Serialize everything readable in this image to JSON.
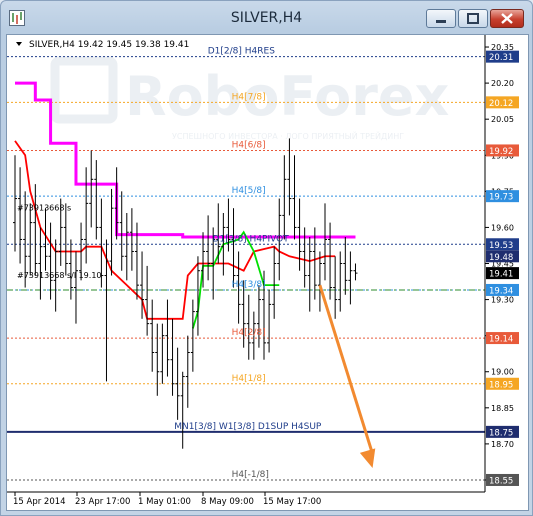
{
  "window": {
    "title": "SILVER,H4"
  },
  "info_bar": {
    "text": "SILVER,H4  19.42 19.45 19.38 19.41"
  },
  "watermark": "RoboForex",
  "watermark_sub": "УСПЕШНОГО ИНВЕСТОРА · ЛОГО ПРИЯТНЫЙ ТРЕЙДИНГ",
  "chart_data": {
    "type": "candlestick",
    "symbol": "SILVER",
    "timeframe": "H4",
    "last": {
      "open": 19.42,
      "high": 19.45,
      "low": 19.38,
      "close": 19.41
    },
    "ylim": [
      18.5,
      20.4
    ],
    "y_ticks": [
      "20.35",
      "20.20",
      "20.05",
      "19.90",
      "19.75",
      "19.60",
      "19.45",
      "19.30",
      "19.15",
      "19.00",
      "18.85",
      "18.70",
      "18.55"
    ],
    "x_ticks": [
      "15 Apr 2014",
      "23 Apr 17:00",
      "1 May 01:00",
      "8 May 09:00",
      "15 May 17:00"
    ],
    "levels": [
      {
        "label": "D1[2/8] H4RES",
        "price": 20.31,
        "badge": "20.31",
        "color": "#1f3d8a",
        "style": "dot",
        "label_color": "#1f3d8a",
        "label_x": 0.42
      },
      {
        "label": "H4[7/8]",
        "price": 20.12,
        "badge": "20.12",
        "color": "#f5a623",
        "style": "dot",
        "label_color": "#f5a623",
        "label_x": 0.47
      },
      {
        "label": "H4[6/8]",
        "price": 19.92,
        "badge": "19.92",
        "color": "#e85a3a",
        "style": "dot",
        "label_color": "#e85a3a",
        "label_x": 0.47
      },
      {
        "label": "H4[5/8]",
        "price": 19.73,
        "badge": "19.73",
        "color": "#2f8fe0",
        "style": "dot",
        "label_color": "#2f8fe0",
        "label_x": 0.47
      },
      {
        "label": "D1[3/8] H4PIVOT",
        "price": 19.53,
        "badge": "19.53",
        "color": "#1f3d8a",
        "style": "dot",
        "label_color": "#1f3d8a",
        "label_x": 0.43
      },
      {
        "label": "H4[3/8]",
        "price": 19.34,
        "badge": "19.34",
        "color": "#2f8fe0",
        "style": "dot",
        "label_color": "#2f8fe0",
        "label_x": 0.47
      },
      {
        "label": "H4[2/8]",
        "price": 19.14,
        "badge": "19.14",
        "color": "#e85a3a",
        "style": "dot",
        "label_color": "#e85a3a",
        "label_x": 0.47
      },
      {
        "label": "H4[1/8]",
        "price": 18.95,
        "badge": "18.95",
        "color": "#f5a623",
        "style": "dot",
        "label_color": "#f5a623",
        "label_x": 0.47
      },
      {
        "label": "MN1[3/8] W1[3/8] D1SUP H4SUP",
        "price": 18.75,
        "badge": "18.75",
        "color": "#1f2d6e",
        "style": "solid",
        "label_color": "#1f3d8a",
        "label_x": 0.35
      },
      {
        "label": "H4[-1/8]",
        "price": 18.55,
        "badge": "18.55",
        "color": "#555555",
        "style": "dot",
        "label_color": "#555555",
        "label_x": 0.47
      }
    ],
    "extra_badges": [
      {
        "price": 19.48,
        "badge": "19.48"
      },
      {
        "price": 19.41,
        "badge": "19.41",
        "dark": true
      }
    ],
    "current_price_line": 19.41,
    "trade_labels": [
      {
        "text": "#73913668 s",
        "price": 19.67
      },
      {
        "text": "#73913668 s/l 19.10",
        "price": 19.39
      }
    ],
    "candles": [
      [
        19.62,
        19.9,
        19.5,
        19.72
      ],
      [
        19.72,
        19.85,
        19.45,
        19.55
      ],
      [
        19.55,
        19.75,
        19.35,
        19.48
      ],
      [
        19.48,
        19.7,
        19.4,
        19.62
      ],
      [
        19.62,
        19.78,
        19.4,
        19.45
      ],
      [
        19.45,
        19.6,
        19.3,
        19.52
      ],
      [
        19.52,
        19.68,
        19.42,
        19.48
      ],
      [
        19.48,
        19.62,
        19.3,
        19.38
      ],
      [
        19.38,
        19.55,
        19.25,
        19.5
      ],
      [
        19.5,
        19.72,
        19.44,
        19.6
      ],
      [
        19.6,
        19.7,
        19.4,
        19.45
      ],
      [
        19.45,
        19.55,
        19.3,
        19.35
      ],
      [
        19.35,
        19.5,
        19.2,
        19.42
      ],
      [
        19.42,
        19.62,
        19.38,
        19.55
      ],
      [
        19.55,
        19.85,
        19.45,
        19.7
      ],
      [
        19.7,
        19.92,
        19.6,
        19.8
      ],
      [
        19.8,
        19.88,
        19.55,
        19.6
      ],
      [
        19.6,
        19.72,
        19.35,
        19.4
      ],
      [
        19.4,
        19.55,
        18.96,
        19.46
      ],
      [
        19.46,
        19.76,
        19.4,
        19.68
      ],
      [
        19.68,
        19.85,
        19.55,
        19.62
      ],
      [
        19.62,
        19.75,
        19.42,
        19.48
      ],
      [
        19.48,
        19.66,
        19.38,
        19.58
      ],
      [
        19.58,
        19.68,
        19.42,
        19.5
      ],
      [
        19.5,
        19.62,
        19.3,
        19.36
      ],
      [
        19.36,
        19.5,
        19.22,
        19.3
      ],
      [
        19.3,
        19.44,
        19.15,
        19.2
      ],
      [
        19.2,
        19.3,
        19.0,
        19.08
      ],
      [
        19.08,
        19.2,
        18.9,
        19.0
      ],
      [
        19.0,
        19.2,
        18.95,
        19.15
      ],
      [
        19.15,
        19.3,
        18.98,
        19.05
      ],
      [
        19.05,
        19.22,
        18.9,
        18.95
      ],
      [
        18.95,
        19.1,
        18.8,
        18.9
      ],
      [
        18.9,
        19.0,
        18.68,
        18.98
      ],
      [
        18.98,
        19.15,
        18.85,
        19.08
      ],
      [
        19.08,
        19.3,
        19.0,
        19.25
      ],
      [
        19.25,
        19.48,
        19.15,
        19.42
      ],
      [
        19.42,
        19.58,
        19.35,
        19.5
      ],
      [
        19.5,
        19.65,
        19.38,
        19.45
      ],
      [
        19.45,
        19.6,
        19.3,
        19.55
      ],
      [
        19.55,
        19.7,
        19.45,
        19.52
      ],
      [
        19.52,
        19.66,
        19.4,
        19.6
      ],
      [
        19.6,
        19.72,
        19.5,
        19.55
      ],
      [
        19.55,
        19.68,
        19.35,
        19.4
      ],
      [
        19.4,
        19.5,
        19.2,
        19.28
      ],
      [
        19.28,
        19.38,
        19.1,
        19.2
      ],
      [
        19.2,
        19.32,
        19.05,
        19.12
      ],
      [
        19.12,
        19.25,
        19.05,
        19.2
      ],
      [
        19.2,
        19.36,
        19.1,
        19.3
      ],
      [
        19.3,
        19.42,
        19.05,
        19.12
      ],
      [
        19.12,
        19.34,
        19.08,
        19.28
      ],
      [
        19.28,
        19.52,
        19.22,
        19.45
      ],
      [
        19.45,
        19.72,
        19.38,
        19.65
      ],
      [
        19.65,
        19.9,
        19.55,
        19.8
      ],
      [
        19.8,
        19.97,
        19.65,
        19.72
      ],
      [
        19.72,
        19.9,
        19.55,
        19.6
      ],
      [
        19.6,
        19.72,
        19.42,
        19.5
      ],
      [
        19.5,
        19.6,
        19.35,
        19.4
      ],
      [
        19.4,
        19.56,
        19.25,
        19.5
      ],
      [
        19.5,
        19.6,
        19.3,
        19.36
      ],
      [
        19.36,
        19.5,
        19.25,
        19.45
      ],
      [
        19.45,
        19.7,
        19.38,
        19.55
      ],
      [
        19.55,
        19.62,
        19.3,
        19.35
      ],
      [
        19.35,
        19.48,
        19.22,
        19.3
      ],
      [
        19.3,
        19.5,
        19.25,
        19.45
      ],
      [
        19.45,
        19.56,
        19.32,
        19.38
      ],
      [
        19.38,
        19.5,
        19.28,
        19.42
      ],
      [
        19.42,
        19.45,
        19.38,
        19.41
      ]
    ],
    "magenta_line": [
      [
        0,
        20.2
      ],
      [
        4,
        20.2
      ],
      [
        4,
        20.13
      ],
      [
        7,
        20.13
      ],
      [
        7,
        19.95
      ],
      [
        12,
        19.95
      ],
      [
        12,
        19.78
      ],
      [
        20,
        19.78
      ],
      [
        20,
        19.57
      ],
      [
        33,
        19.57
      ],
      [
        33,
        19.56
      ],
      [
        67,
        19.56
      ]
    ],
    "red_line": [
      [
        0,
        19.96
      ],
      [
        2,
        19.9
      ],
      [
        3,
        19.75
      ],
      [
        5,
        19.6
      ],
      [
        8,
        19.5
      ],
      [
        13,
        19.5
      ],
      [
        14,
        19.52
      ],
      [
        17,
        19.52
      ],
      [
        19,
        19.42
      ],
      [
        22,
        19.36
      ],
      [
        25,
        19.3
      ],
      [
        26,
        19.22
      ],
      [
        33,
        19.22
      ],
      [
        34,
        19.4
      ],
      [
        36,
        19.45
      ],
      [
        42,
        19.45
      ],
      [
        45,
        19.42
      ],
      [
        47,
        19.5
      ],
      [
        51,
        19.52
      ],
      [
        52,
        19.5
      ],
      [
        54,
        19.48
      ],
      [
        58,
        19.46
      ],
      [
        61,
        19.48
      ],
      [
        63,
        19.48
      ]
    ],
    "green_line": [
      [
        35,
        19.18
      ],
      [
        36,
        19.25
      ],
      [
        37,
        19.44
      ],
      [
        39,
        19.44
      ],
      [
        41,
        19.53
      ],
      [
        44,
        19.55
      ],
      [
        45,
        19.58
      ],
      [
        47,
        19.5
      ],
      [
        49,
        19.36
      ],
      [
        52,
        19.36
      ]
    ],
    "arrow": {
      "from": [
        60,
        19.36
      ],
      "to": [
        68,
        18.6
      ],
      "color": "#f28a30"
    }
  }
}
